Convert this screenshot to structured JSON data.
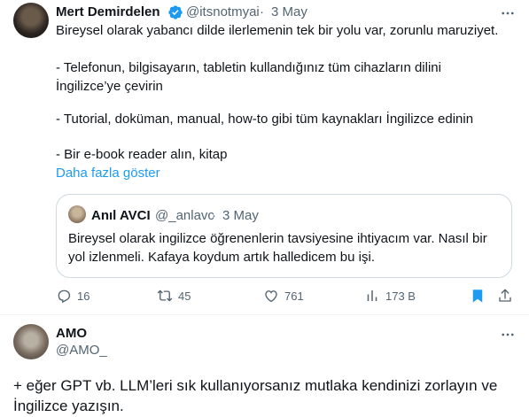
{
  "tweet": {
    "author_name": "Mert Demirdelen",
    "handle": "@itsnotmyai",
    "separator": "·",
    "date": "3 May",
    "lines": [
      "Bireysel olarak yabancı dilde ilerlemenin tek bir yolu var, zorunlu maruziyet.",
      "- Telefonun, bilgisayarın, tabletin kullandığınız tüm cihazların dilini",
      "İngilizce’ye çevirin",
      "- Tutorial, doküman, manual, how-to gibi tüm kaynakları İngilizce edinin",
      "- Bir e-book reader alın, kitap"
    ],
    "show_more": "Daha fazla göster",
    "quote": {
      "author_name": "Anıl AVCI",
      "handle": "@_anlavc",
      "separator": "·",
      "date": "3 May",
      "lines": [
        "Bireysel olarak ingilizce öğrenenlerin tavsiyesine ihtiyacım var. Nasıl bir",
        "yol izlenmeli. Kafaya koydum artık halledicem bu işi."
      ]
    },
    "actions": {
      "replies": "16",
      "retweets": "45",
      "likes": "761",
      "views": "173 B"
    }
  },
  "reply": {
    "author_name": "AMO",
    "handle": "@AMO_",
    "lines": [
      "+ eğer GPT vb. LLM’leri sık kullanıyorsanız mutlaka kendinizi zorlayın ve",
      "İngilizce yazışın."
    ]
  },
  "colors": {
    "accent": "#1d9bf0",
    "muted": "#536471",
    "text": "#0f1419",
    "border": "#cfd9de"
  },
  "icons": [
    "verified-badge-icon",
    "more-icon",
    "reply-icon",
    "retweet-icon",
    "like-icon",
    "views-icon",
    "bookmark-icon",
    "share-icon"
  ]
}
